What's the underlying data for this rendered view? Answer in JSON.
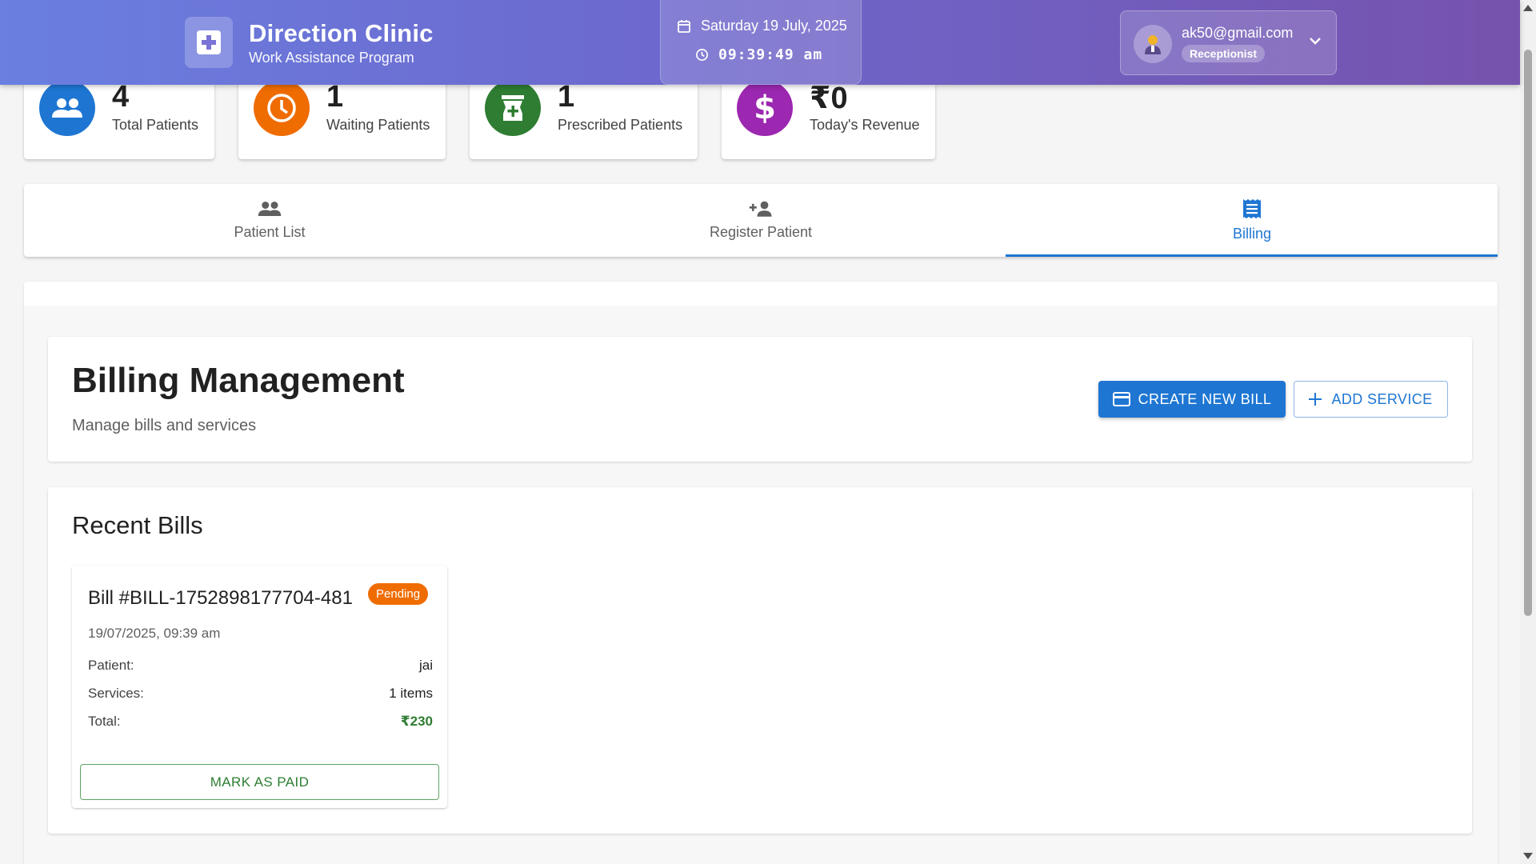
{
  "header": {
    "brand_title": "Direction Clinic",
    "brand_subtitle": "Work Assistance Program",
    "date": "Saturday 19 July, 2025",
    "time": "09:39:49 am",
    "user_email": "ak50@gmail.com",
    "user_role": "Receptionist"
  },
  "stats": [
    {
      "value": "4",
      "label": "Total Patients",
      "icon": "people-icon",
      "color": "#1e76d2"
    },
    {
      "value": "1",
      "label": "Waiting Patients",
      "icon": "clock-icon",
      "color": "#ef6c00"
    },
    {
      "value": "1",
      "label": "Prescribed Patients",
      "icon": "medicine-icon",
      "color": "#2e7d32"
    },
    {
      "value": "₹0",
      "label": "Today's Revenue",
      "icon": "dollar-icon",
      "color": "#9c27b0"
    }
  ],
  "tabs": [
    {
      "label": "Patient List",
      "icon": "people-icon",
      "active": false
    },
    {
      "label": "Register Patient",
      "icon": "person-add-icon",
      "active": false
    },
    {
      "label": "Billing",
      "icon": "receipt-icon",
      "active": true
    }
  ],
  "billing": {
    "title": "Billing Management",
    "subtitle": "Manage bills and services",
    "create_label": "CREATE NEW BILL",
    "add_service_label": "ADD SERVICE"
  },
  "recent": {
    "title": "Recent Bills",
    "bills": [
      {
        "title": "Bill #BILL-1752898177704-481",
        "status": "Pending",
        "datetime": "19/07/2025, 09:39 am",
        "patient_key": "Patient:",
        "patient": "jai",
        "services_key": "Services:",
        "services": "1 items",
        "total_key": "Total:",
        "total": "₹230",
        "action_label": "MARK AS PAID"
      }
    ]
  },
  "colors": {
    "primary": "#1e76d2",
    "pending": "#ef6c00",
    "success": "#2e7d32"
  }
}
